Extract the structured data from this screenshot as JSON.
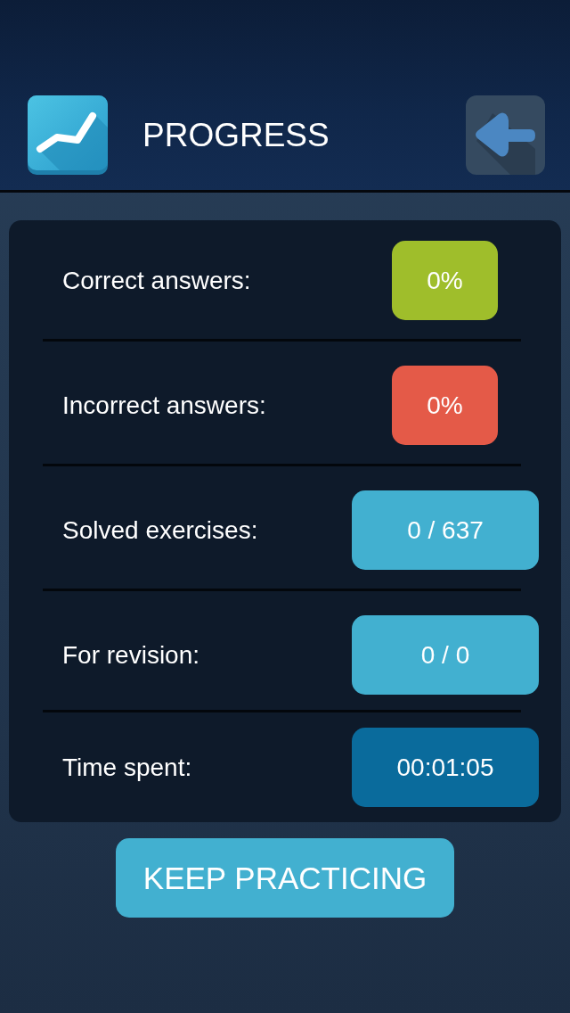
{
  "header": {
    "title": "PROGRESS"
  },
  "stats": [
    {
      "label": "Correct answers:",
      "value": "0%",
      "kind": "percent",
      "color": "#9fbe2b"
    },
    {
      "label": "Incorrect answers:",
      "value": "0%",
      "kind": "percent",
      "color": "#e45a48"
    },
    {
      "label": "Solved exercises:",
      "value": "0 / 637",
      "kind": "count",
      "color": "#42b0d0"
    },
    {
      "label": "For revision:",
      "value": "0 / 0",
      "kind": "count",
      "color": "#42b0d0"
    },
    {
      "label": "Time spent:",
      "value": "00:01:05",
      "kind": "time",
      "color": "#0a6b9c"
    }
  ],
  "action_button": {
    "label": "KEEP PRACTICING"
  }
}
